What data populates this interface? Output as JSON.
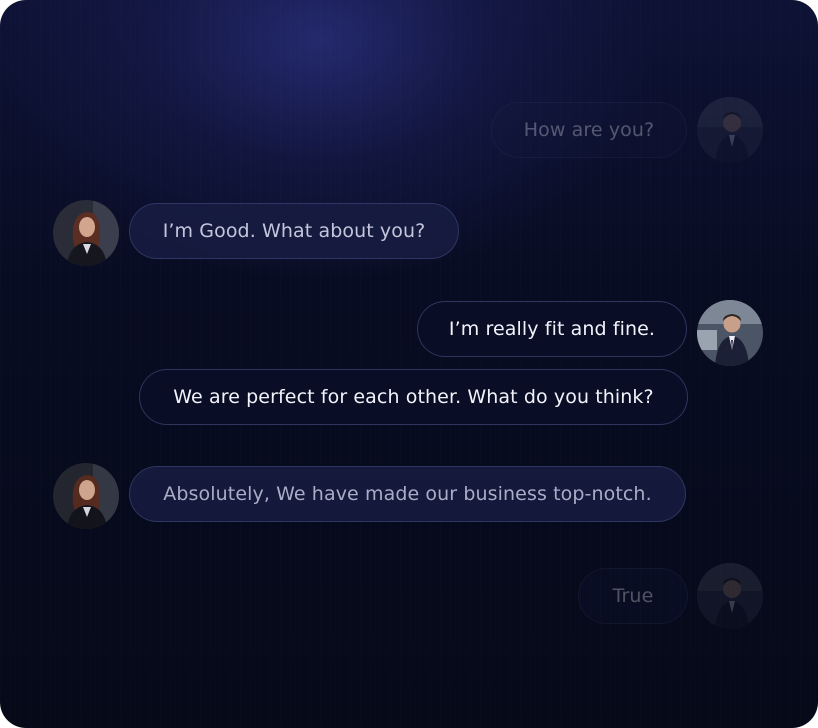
{
  "chat": {
    "messages": [
      {
        "text": "How are you?"
      },
      {
        "text": "I’m Good. What about you?"
      },
      {
        "text": "I’m really fit and fine."
      },
      {
        "text": "We are perfect for each other. What do you think?"
      },
      {
        "text": "Absolutely, We have made our business top-notch."
      },
      {
        "text": "True"
      }
    ]
  },
  "colors": {
    "background_top": "#0e1235",
    "background_bottom": "#050918",
    "bubble_text": "#e8eaf4",
    "bubble_border": "#6e78be"
  }
}
